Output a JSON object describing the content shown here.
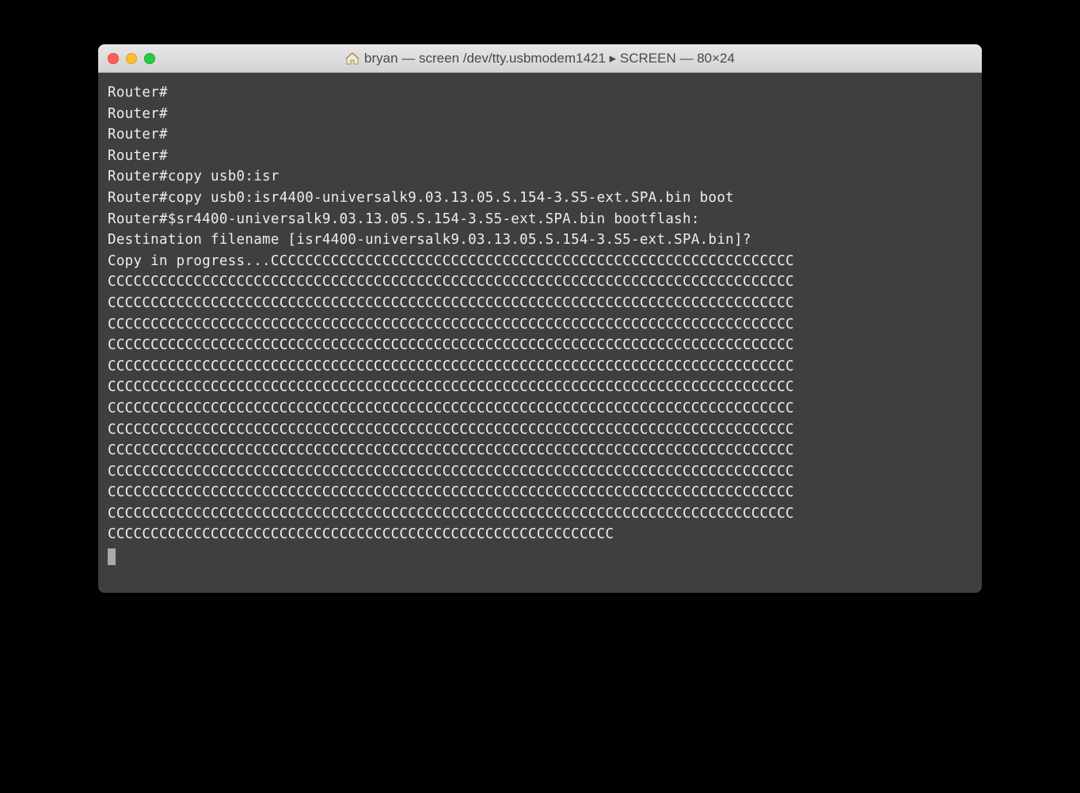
{
  "window": {
    "title": "bryan — screen /dev/tty.usbmodem1421 ▸ SCREEN — 80×24"
  },
  "terminal": {
    "lines": [
      "Router#",
      "Router#",
      "Router#",
      "Router#",
      "Router#copy usb0:isr",
      "Router#copy usb0:isr4400-universalk9.03.13.05.S.154-3.S5-ext.SPA.bin boot",
      "Router#$sr4400-universalk9.03.13.05.S.154-3.S5-ext.SPA.bin bootflash:",
      "Destination filename [isr4400-universalk9.03.13.05.S.154-3.S5-ext.SPA.bin]?",
      "Copy in progress...CCCCCCCCCCCCCCCCCCCCCCCCCCCCCCCCCCCCCCCCCCCCCCCCCCCCCCCCCCCCC",
      "CCCCCCCCCCCCCCCCCCCCCCCCCCCCCCCCCCCCCCCCCCCCCCCCCCCCCCCCCCCCCCCCCCCCCCCCCCCCCCCC",
      "CCCCCCCCCCCCCCCCCCCCCCCCCCCCCCCCCCCCCCCCCCCCCCCCCCCCCCCCCCCCCCCCCCCCCCCCCCCCCCCC",
      "CCCCCCCCCCCCCCCCCCCCCCCCCCCCCCCCCCCCCCCCCCCCCCCCCCCCCCCCCCCCCCCCCCCCCCCCCCCCCCCC",
      "CCCCCCCCCCCCCCCCCCCCCCCCCCCCCCCCCCCCCCCCCCCCCCCCCCCCCCCCCCCCCCCCCCCCCCCCCCCCCCCC",
      "CCCCCCCCCCCCCCCCCCCCCCCCCCCCCCCCCCCCCCCCCCCCCCCCCCCCCCCCCCCCCCCCCCCCCCCCCCCCCCCC",
      "CCCCCCCCCCCCCCCCCCCCCCCCCCCCCCCCCCCCCCCCCCCCCCCCCCCCCCCCCCCCCCCCCCCCCCCCCCCCCCCC",
      "CCCCCCCCCCCCCCCCCCCCCCCCCCCCCCCCCCCCCCCCCCCCCCCCCCCCCCCCCCCCCCCCCCCCCCCCCCCCCCCC",
      "CCCCCCCCCCCCCCCCCCCCCCCCCCCCCCCCCCCCCCCCCCCCCCCCCCCCCCCCCCCCCCCCCCCCCCCCCCCCCCCC",
      "CCCCCCCCCCCCCCCCCCCCCCCCCCCCCCCCCCCCCCCCCCCCCCCCCCCCCCCCCCCCCCCCCCCCCCCCCCCCCCCC",
      "CCCCCCCCCCCCCCCCCCCCCCCCCCCCCCCCCCCCCCCCCCCCCCCCCCCCCCCCCCCCCCCCCCCCCCCCCCCCCCCC",
      "CCCCCCCCCCCCCCCCCCCCCCCCCCCCCCCCCCCCCCCCCCCCCCCCCCCCCCCCCCCCCCCCCCCCCCCCCCCCCCCC",
      "CCCCCCCCCCCCCCCCCCCCCCCCCCCCCCCCCCCCCCCCCCCCCCCCCCCCCCCCCCCCCCCCCCCCCCCCCCCCCCCC",
      "CCCCCCCCCCCCCCCCCCCCCCCCCCCCCCCCCCCCCCCCCCCCCCCCCCCCCCCCCCC"
    ]
  }
}
